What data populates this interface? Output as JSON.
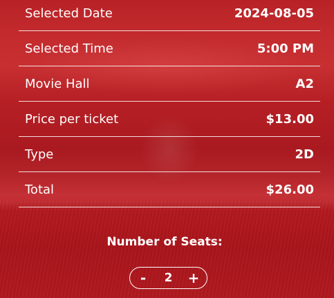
{
  "booking": {
    "rows": [
      {
        "label": "Selected Date",
        "value": "2024-08-05"
      },
      {
        "label": "Selected Time",
        "value": "5:00 PM"
      },
      {
        "label": "Movie Hall",
        "value": "A2"
      },
      {
        "label": "Price per ticket",
        "value": "$13.00"
      },
      {
        "label": "Type",
        "value": "2D"
      },
      {
        "label": "Total",
        "value": "$26.00"
      }
    ]
  },
  "seats": {
    "title": "Number of Seats:",
    "decrement": "-",
    "quantity": "2",
    "increment": "+"
  },
  "theme": {
    "background": "#b01c22",
    "text": "#ffffff"
  }
}
